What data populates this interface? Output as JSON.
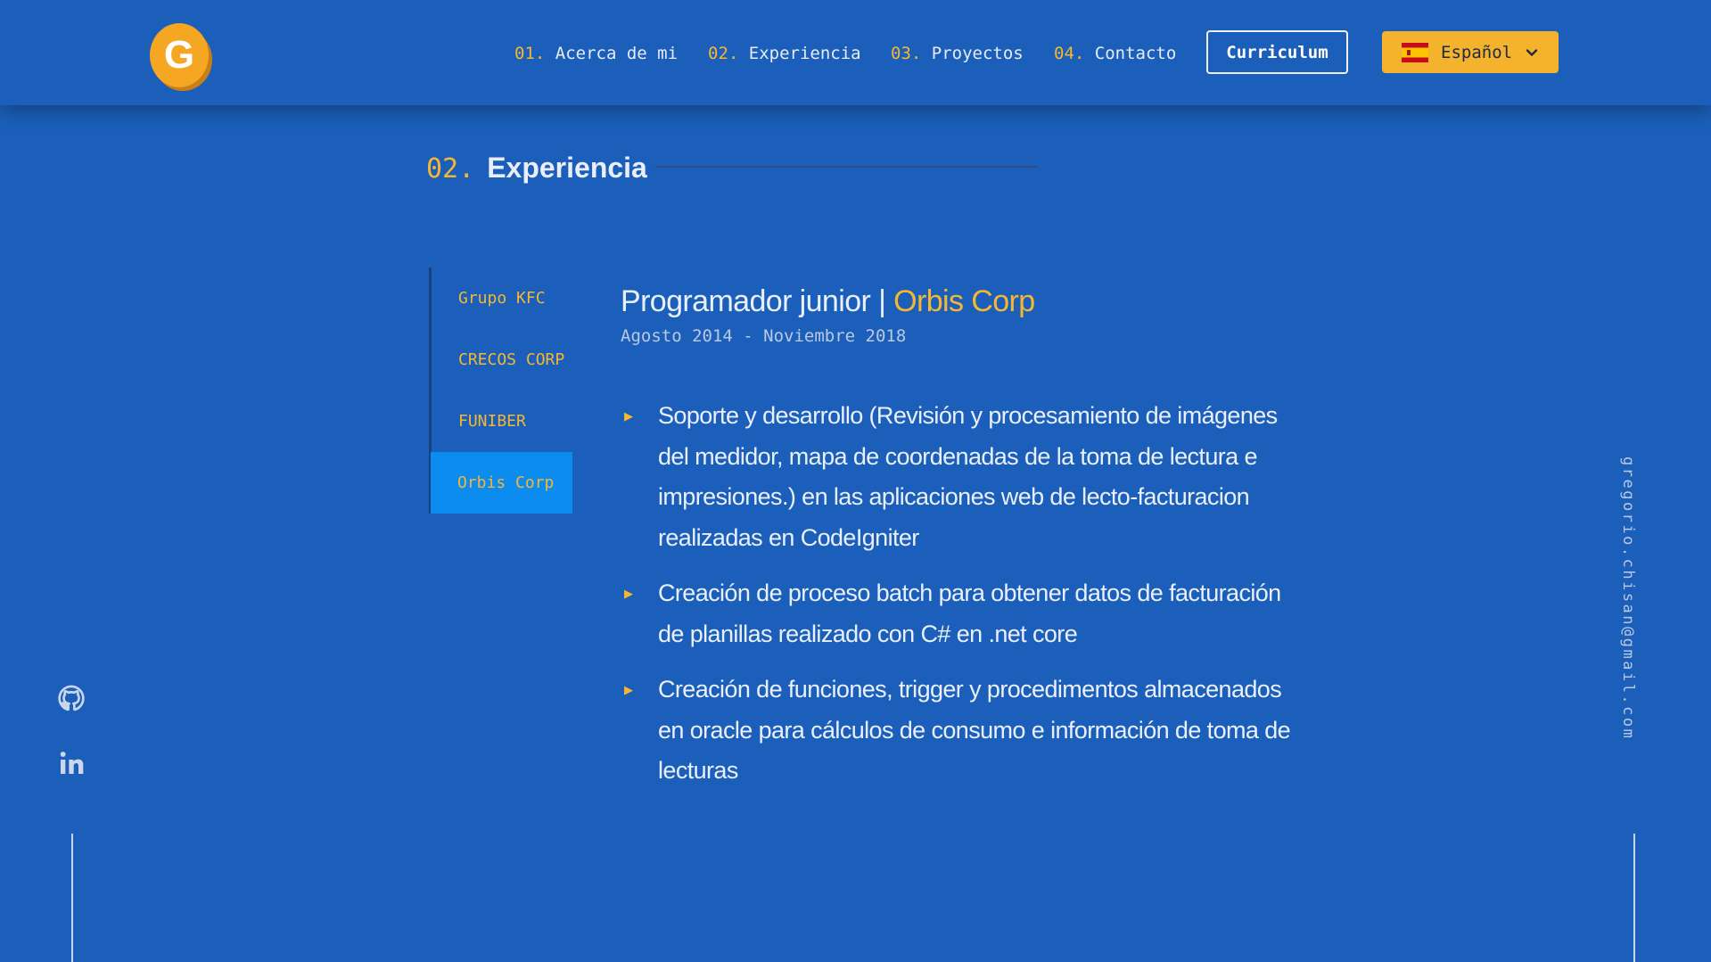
{
  "header": {
    "logo_letter": "G",
    "nav": [
      {
        "num": "01.",
        "label": "Acerca de mi"
      },
      {
        "num": "02.",
        "label": "Experiencia"
      },
      {
        "num": "03.",
        "label": "Proyectos"
      },
      {
        "num": "04.",
        "label": "Contacto"
      }
    ],
    "cv_label": "Curriculum",
    "language": {
      "label": "Español",
      "flag_icon": "spain-flag-icon"
    }
  },
  "section": {
    "num": "02.",
    "title": "Experiencia"
  },
  "tabs": [
    {
      "label": "Grupo KFC",
      "active": false
    },
    {
      "label": "CRECOS CORP",
      "active": false
    },
    {
      "label": "FUNIBER",
      "active": false
    },
    {
      "label": "Orbis Corp",
      "active": true
    }
  ],
  "job": {
    "role": "Programador junior",
    "separator": " | ",
    "company": "Orbis Corp",
    "dates": "Agosto 2014 - Noviembre 2018",
    "bullets": [
      "Soporte y desarrollo (Revisión y procesamiento de imágenes del medidor, mapa de coordenadas de la toma de lectura e impresiones.) en las aplicaciones web de lecto-facturacion realizadas en CodeIgniter",
      "Creación de proceso batch para obtener datos de facturación de planillas realizado con C# en .net core",
      "Creación de funciones, trigger y procedimentos almacenados en oracle para cálculos de consumo e información de toma de lecturas"
    ]
  },
  "social": [
    {
      "icon": "github-icon"
    },
    {
      "icon": "linkedin-icon"
    }
  ],
  "email": "gregorio.chisan@gmail.com",
  "colors": {
    "background": "#1b5fba",
    "accent": "#f5b731",
    "active_tab": "#0d8cf0",
    "text": "#eaf0fa"
  }
}
